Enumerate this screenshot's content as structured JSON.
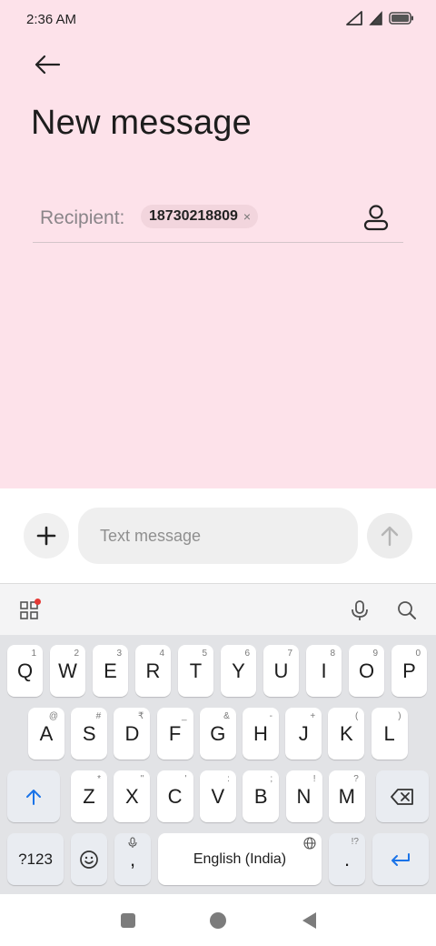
{
  "status": {
    "time": "2:36 AM"
  },
  "header": {
    "title": "New message"
  },
  "recipient": {
    "label": "Recipient:",
    "chip": "18730218809",
    "chip_remove": "×"
  },
  "compose": {
    "placeholder": "Text message"
  },
  "keyboard": {
    "row1": [
      {
        "k": "Q",
        "h": "1"
      },
      {
        "k": "W",
        "h": "2"
      },
      {
        "k": "E",
        "h": "3"
      },
      {
        "k": "R",
        "h": "4"
      },
      {
        "k": "T",
        "h": "5"
      },
      {
        "k": "Y",
        "h": "6"
      },
      {
        "k": "U",
        "h": "7"
      },
      {
        "k": "I",
        "h": "8"
      },
      {
        "k": "O",
        "h": "9"
      },
      {
        "k": "P",
        "h": "0"
      }
    ],
    "row2": [
      {
        "k": "A",
        "h": "@"
      },
      {
        "k": "S",
        "h": "#"
      },
      {
        "k": "D",
        "h": "₹"
      },
      {
        "k": "F",
        "h": "_"
      },
      {
        "k": "G",
        "h": "&"
      },
      {
        "k": "H",
        "h": "-"
      },
      {
        "k": "J",
        "h": "+"
      },
      {
        "k": "K",
        "h": "("
      },
      {
        "k": "L",
        "h": ")"
      }
    ],
    "row3": [
      {
        "k": "Z",
        "h": "*"
      },
      {
        "k": "X",
        "h": "\""
      },
      {
        "k": "C",
        "h": "'"
      },
      {
        "k": "V",
        "h": ":"
      },
      {
        "k": "B",
        "h": ";"
      },
      {
        "k": "N",
        "h": "!"
      },
      {
        "k": "M",
        "h": "?"
      }
    ],
    "symbols_key": "?123",
    "comma_key": ",",
    "space_key": "English (India)",
    "period_key": ".",
    "period_hint": "!?"
  },
  "colors": {
    "top_bg": "#fde2ea",
    "accent_blue": "#1a73e8",
    "keyboard_bg": "#e2e3e6"
  },
  "icons": [
    "back-arrow-icon",
    "contact-icon",
    "plus-icon",
    "send-arrow-icon",
    "apps-grid-icon",
    "mic-icon",
    "search-icon",
    "shift-icon",
    "backspace-icon",
    "emoji-icon",
    "globe-icon",
    "enter-icon",
    "recents-icon",
    "home-icon",
    "back-icon"
  ]
}
